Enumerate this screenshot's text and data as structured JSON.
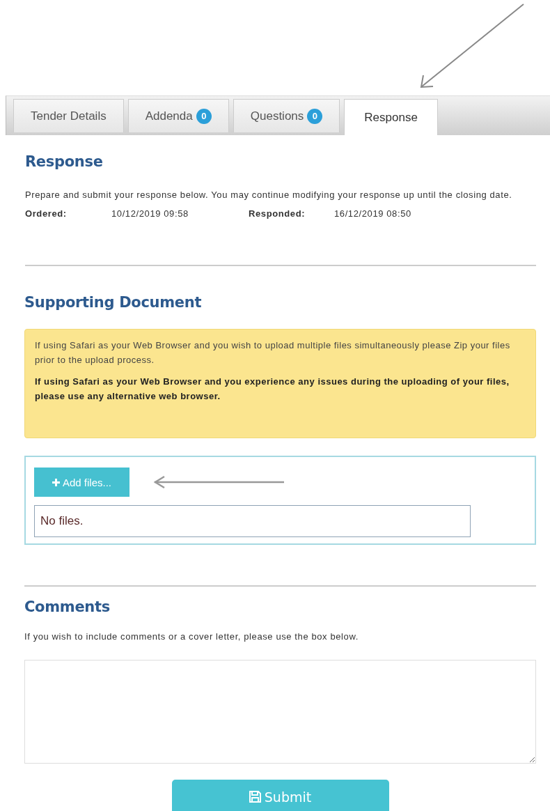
{
  "tabs": [
    {
      "label": "Tender Details",
      "selected": false
    },
    {
      "label": "Addenda",
      "badge": "0",
      "selected": false
    },
    {
      "label": "Questions",
      "badge": "0",
      "selected": false
    },
    {
      "label": "Response",
      "selected": true
    }
  ],
  "response": {
    "title": "Response",
    "description": "Prepare and submit your response below. You may continue modifying your response up until the closing date.",
    "fields": [
      {
        "label": "Ordered:",
        "value": "10/12/2019 09:58"
      },
      {
        "label": "Responded:",
        "value": "16/12/2019 08:50"
      }
    ]
  },
  "supporting_document": {
    "title": "Supporting Document",
    "notices": [
      {
        "text": "If using Safari as your Web Browser and you wish to upload multiple files simultaneously please Zip your files prior to the upload process.",
        "bold": false
      },
      {
        "text": "If using Safari as your Web Browser and you experience any issues during the uploading of your files, please use any alternative web browser.",
        "bold": true
      }
    ],
    "add_button": "Add files...",
    "file_list": "No files."
  },
  "comments": {
    "title": "Comments",
    "description": "If you wish to include comments or a cover letter, please use the box below.",
    "submit": "Submit"
  }
}
